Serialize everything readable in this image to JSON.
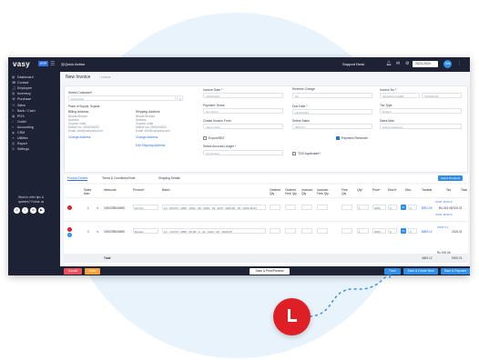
{
  "app": {
    "logo": "vasy",
    "badge": "ERP",
    "quick_action": "Quick Action",
    "support": "Support Desk",
    "year": "2023-2024",
    "avatar": "DW"
  },
  "sidebar": {
    "items": [
      "Dashboard",
      "Contact",
      "Employee",
      "Inventory",
      "Purchase",
      "Sales",
      "Bank / Cash",
      "POS",
      "Outlet",
      "Accounting",
      "CRM",
      "Utilities",
      "Report",
      "Settings"
    ],
    "help": "Want to refer tips & updates? Follow us"
  },
  "page": {
    "title": "New Invoice",
    "breadcrumb": "/ Invoice"
  },
  "form": {
    "customer_label": "Select Customer*",
    "customer_value": "Mysticseal",
    "supply_label": "Place of Supply: Gujarat",
    "billing_label": "Billing Address",
    "billing_lines": [
      "Bharat Bhavan",
      "Address",
      "Gujarat, India",
      "Mobile No: 0000000000",
      "Email: info@company.com"
    ],
    "shipping_label": "Shipping Address",
    "shipping_lines": [
      "Bharat Bhavan",
      "Address",
      "Gujarat, India",
      "Mobile No: 0000000000",
      "Email: info@company.com"
    ],
    "change_address": "Change Address",
    "edit_shipping": "Edit Shipping Address",
    "invoice_date_label": "Invoice Date *",
    "invoice_date": "22/03/2023",
    "payment_terms_label": "Payment Terms",
    "payment_terms": "Net Terms",
    "create_from_label": "Create Invoice From",
    "create_from": "Sales Order",
    "export_label": "Export/SEZ",
    "account_ledger_label": "Select Account Ledger *",
    "account_ledger": "Accounting",
    "reverse_label": "Reverse Charge",
    "reverse_value": "No",
    "due_date_label": "Due Date *",
    "due_date": "22/03/2023",
    "select_sales_label": "Select Sales",
    "select_sales": "0803-01",
    "payment_reminder": "Payment Reminder",
    "tds_label": "TDS Applicable?",
    "invoice_no_label": "Invoice No *",
    "invoice_prefix": "INV/2023-24/ABC",
    "invoice_no": "INV0001/02",
    "tax_type_label": "Tax Type",
    "tax_type": "Default",
    "sales_man_label": "Sales Man",
    "sales_man": "Select Salesman"
  },
  "tabs": [
    "Product Details",
    "Terms & Conditions/Note",
    "Shipping Details"
  ],
  "select_products": "Select Products",
  "table": {
    "headers": [
      "Sales Man",
      "Itemcode",
      "Product*",
      "Batch",
      "Ordered Qty",
      "Ordered Free Qty",
      "Invoiced Qty",
      "Invoiced Free Qty",
      "Free Qty",
      "Qty*",
      "Price*",
      "Disc%",
      "Disc",
      "Taxable",
      "Tax",
      "Total"
    ],
    "rows": [
      {
        "sr": "1",
        "code": "1000295046590",
        "product": "Air Dro...",
        "batch": "1C : 8XXXX : MRP : 1000 : UP : 3000 : S3 : EXP : 2025-05 : 00 : 2023-05-03",
        "ordered": "",
        "oqty": "",
        "iqty": "",
        "ifree": "",
        "free": "",
        "qty": "1",
        "price": "3000",
        "disc": "0",
        "taxable": "$591.06",
        "tax_a": "CGST 18.00 %",
        "tax_b": "Rs 243.45",
        "tax_c": "CGST 18.00 %",
        "total": "7100.01"
      },
      {
        "sr": "2",
        "code": "1000295046590",
        "product": "Beeble...",
        "batch": "1C : 1XXXX : MRP : 50.98 : S : 24 : 1000 : UP : 2025-05",
        "ordered": "",
        "oqty": "",
        "iqty": "",
        "ifree": "",
        "free": "",
        "qty": "1",
        "price": "2000",
        "disc": "0",
        "taxable": "$809.12",
        "tax_a": "CGST 5.1",
        "tax_b": "Rs 195.48",
        "tax_c": "",
        "total": "2100.01"
      }
    ],
    "total_label": "Total",
    "total_value": "4669.12",
    "total_tax": "Rs 195.48",
    "grand": "9200.01"
  },
  "footer": {
    "cancel": "Cancel",
    "clear": "Clear",
    "save_print": "Save & Print/Preview",
    "save": "Save",
    "save_create": "Save & Create New",
    "save_payment": "Save & Payment"
  },
  "colors": {
    "sidebar": "#1e2235",
    "accent": "#2f8ee8",
    "danger": "#de1f26",
    "clear": "#f2a23a"
  }
}
